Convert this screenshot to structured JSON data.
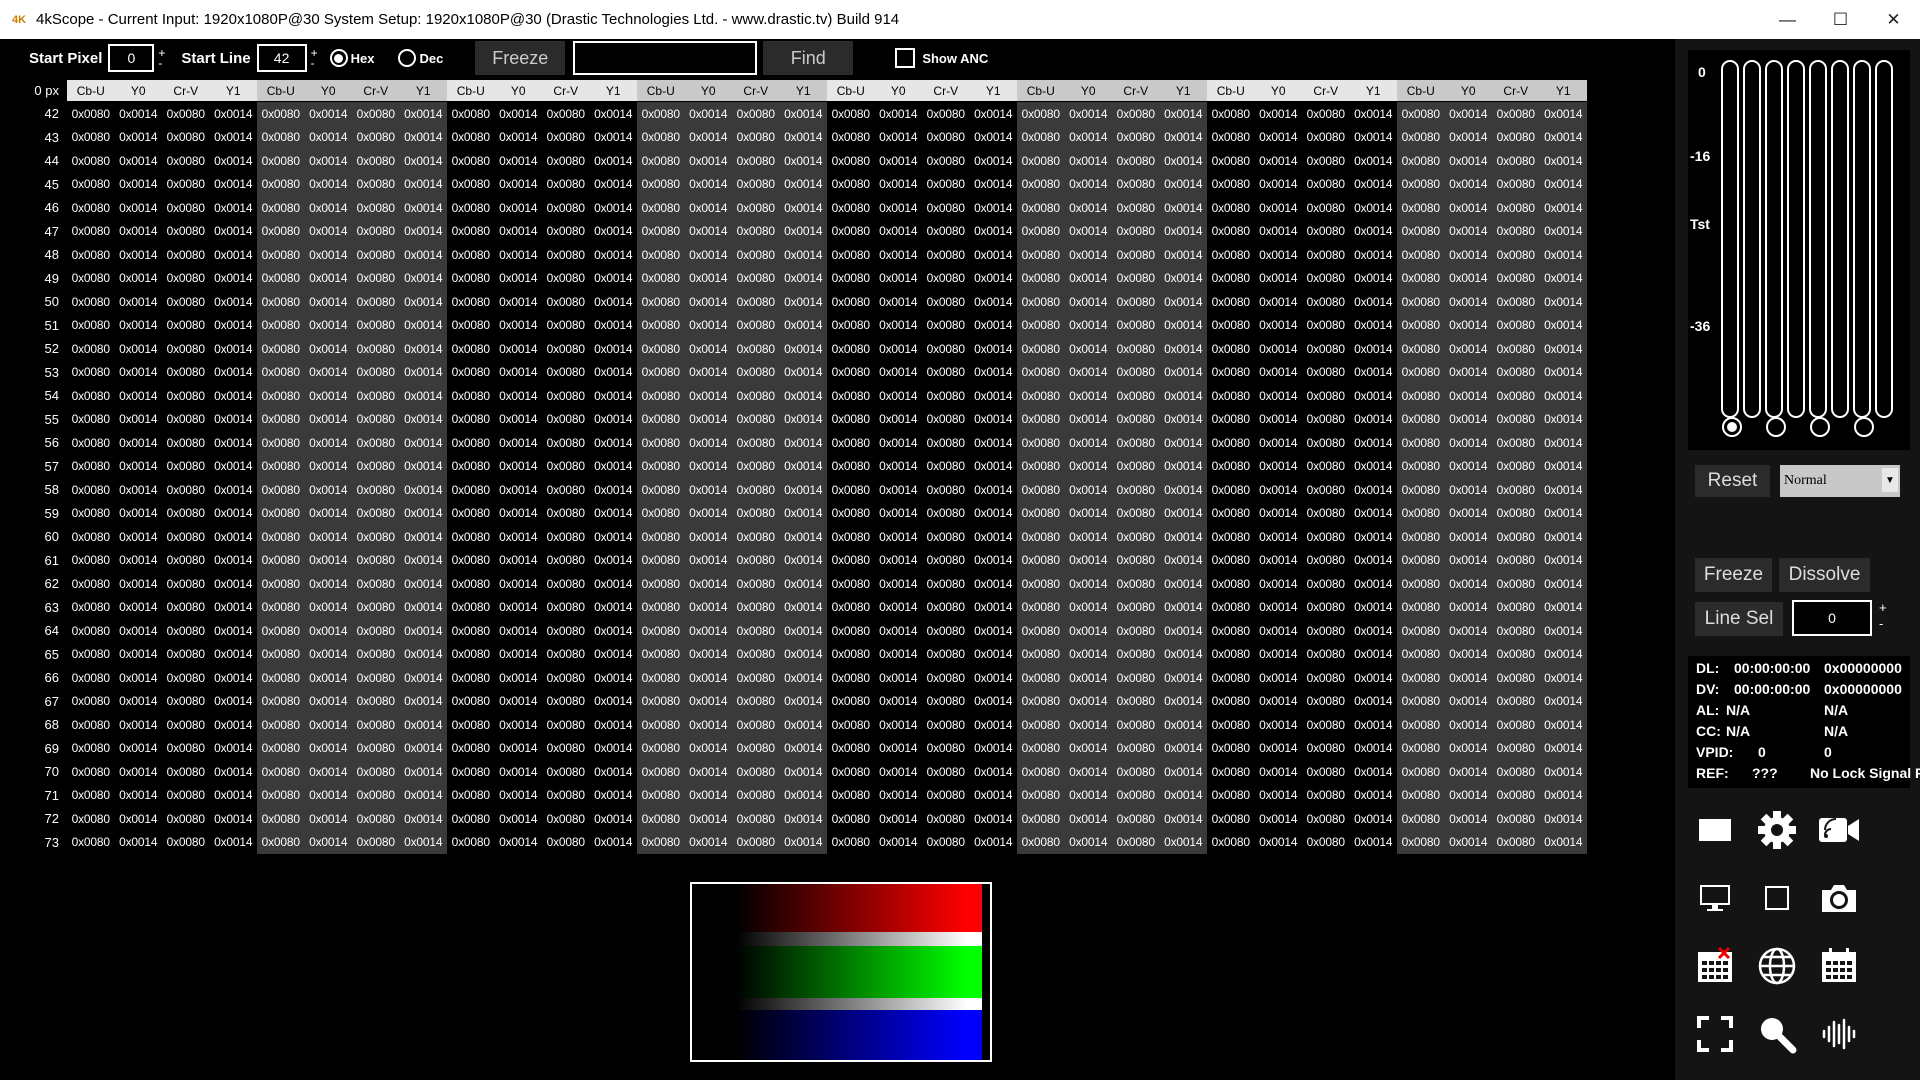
{
  "titlebar": {
    "logo": "4K",
    "title": "4kScope -   Current Input: 1920x1080P@30   System Setup: 1920x1080P@30    (Drastic Technologies Ltd. - www.drastic.tv) Build 914",
    "minimize": "—",
    "maximize": "☐",
    "close": "✕"
  },
  "toolbar": {
    "start_pixel_label": "Start Pixel",
    "start_pixel_value": "0",
    "start_line_label": "Start Line",
    "start_line_value": "42",
    "hex_label": "Hex",
    "dec_label": "Dec",
    "freeze_label": "Freeze",
    "find_value": "",
    "find_label": "Find",
    "show_anc_label": "Show ANC",
    "spin_plus": "+",
    "spin_minus": "-"
  },
  "grid": {
    "corner_label": "0 px",
    "headers": [
      "Cb-U",
      "Y0",
      "Cr-V",
      "Y1",
      "Cb-U",
      "Y0",
      "Cr-V",
      "Y1",
      "Cb-U",
      "Y0",
      "Cr-V",
      "Y1",
      "Cb-U",
      "Y0",
      "Cr-V",
      "Y1",
      "Cb-U",
      "Y0",
      "Cr-V",
      "Y1",
      "Cb-U",
      "Y0",
      "Cr-V",
      "Y1",
      "Cb-U",
      "Y0",
      "Cr-V",
      "Y1",
      "Cb-U",
      "Y0",
      "Cr-V",
      "Y1"
    ],
    "row_labels": [
      "42",
      "43",
      "44",
      "45",
      "46",
      "47",
      "48",
      "49",
      "50",
      "51",
      "52",
      "53",
      "54",
      "55",
      "56",
      "57",
      "58",
      "59",
      "60",
      "61",
      "62",
      "63",
      "64",
      "65",
      "66",
      "67",
      "68",
      "69",
      "70",
      "71",
      "72",
      "73"
    ],
    "row_pattern": [
      "0x0080",
      "0x0014",
      "0x0080",
      "0x0014"
    ],
    "group_colors": [
      "#000000",
      "#3a3a3a"
    ]
  },
  "right_panel": {
    "meter_labels": [
      "0",
      "-16",
      "Tst",
      "-36"
    ],
    "reset_label": "Reset",
    "mode_value": "Normal",
    "freeze_label": "Freeze",
    "dissolve_label": "Dissolve",
    "line_sel_label": "Line Sel",
    "line_sel_value": "0",
    "spin_plus": "+",
    "spin_minus": "-",
    "info": {
      "dl_label": "DL:",
      "dl_time": "00:00:00:00",
      "dl_hex": "0x00000000",
      "dv_label": "DV:",
      "dv_time": "00:00:00:00",
      "dv_hex": "0x00000000",
      "al_label": "AL:",
      "al_1": "N/A",
      "al_2": "N/A",
      "cc_label": "CC:",
      "cc_1": "N/A",
      "cc_2": "N/A",
      "vpid_label": "VPID:",
      "vpid_1": "0",
      "vpid_2": "0",
      "ref_label": "REF:",
      "ref_1": "???",
      "ref_2": "No Lock Signal Pr"
    },
    "icons": [
      "window-icon",
      "gear-icon",
      "camera-stream-icon",
      "monitor-icon",
      "square-icon",
      "camera-icon",
      "calendar-x-icon",
      "globe-icon",
      "calendar-icon",
      "fullscreen-icon",
      "search-icon",
      "audio-waveform-icon"
    ]
  },
  "colors": {
    "header_bg": "#e6e6e6",
    "panel_bg": "#141414",
    "button_bg": "#2b2b2b"
  }
}
